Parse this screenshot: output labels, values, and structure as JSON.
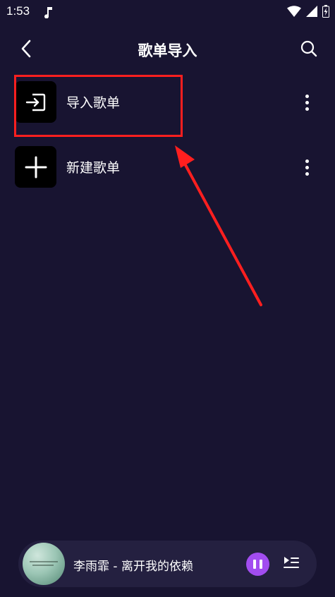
{
  "status": {
    "time": "1:53",
    "icons": [
      "music-note-icon",
      "wifi-icon",
      "signal-icon",
      "battery-icon"
    ]
  },
  "header": {
    "title": "歌单导入",
    "back_icon": "chevron-left-icon",
    "search_icon": "search-icon"
  },
  "items": [
    {
      "label": "导入歌单",
      "icon": "import-icon",
      "more_icon": "more-vertical-icon"
    },
    {
      "label": "新建歌单",
      "icon": "plus-icon",
      "more_icon": "more-vertical-icon"
    }
  ],
  "annotation": {
    "highlight_color": "#ff1f1f"
  },
  "player": {
    "song": "李雨霏 - 离开我的依赖",
    "pause_icon": "pause-icon",
    "playlist_icon": "playlist-icon",
    "accent": "#a24df0"
  },
  "colors": {
    "background": "#181431",
    "player_bg": "#242040"
  }
}
